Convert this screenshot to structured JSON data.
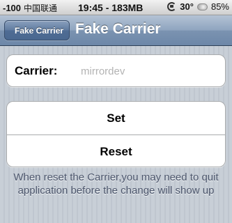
{
  "status_bar": {
    "signal": "-100",
    "carrier": "中国联通",
    "time_memory": "19:45 - 183MB",
    "temperature": "30°",
    "battery": "85%",
    "icons": [
      "rotation-lock-icon",
      "weather-icon"
    ]
  },
  "nav_bar": {
    "back_label": "Fake Carrier",
    "title": "Fake Carrier"
  },
  "form": {
    "carrier_label": "Carrier:",
    "carrier_value": "",
    "carrier_placeholder": "mirrordev"
  },
  "actions": {
    "set_label": "Set",
    "reset_label": "Reset"
  },
  "footer": {
    "note": "When reset the Carrier,you may need to quit application before the change will show up"
  },
  "colors": {
    "nav_bar": "#6d87a8",
    "background": "#c5ccd4",
    "footer_text": "#4c566c"
  }
}
